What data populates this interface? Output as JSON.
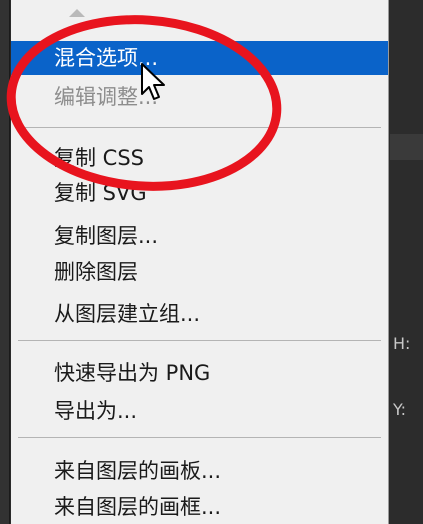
{
  "menu": {
    "items": [
      {
        "label": "混合选项...",
        "state": "highlighted"
      },
      {
        "label": "编辑调整...",
        "state": "disabled"
      },
      {
        "label": "复制 CSS",
        "state": "normal"
      },
      {
        "label": "复制 SVG",
        "state": "normal"
      },
      {
        "label": "复制图层...",
        "state": "normal"
      },
      {
        "label": "删除图层",
        "state": "normal"
      },
      {
        "label": "从图层建立组...",
        "state": "normal"
      },
      {
        "label": "快速导出为 PNG",
        "state": "normal"
      },
      {
        "label": "导出为...",
        "state": "normal"
      },
      {
        "label": "来自图层的画板...",
        "state": "normal"
      },
      {
        "label": "来自图层的画框...",
        "state": "normal"
      }
    ]
  },
  "background_panel": {
    "h_label": "H:",
    "y_label": "Y:"
  },
  "colors": {
    "menu_bg": "#f0f0f0",
    "highlight": "#0a63c9",
    "disabled_text": "#8d8d8d",
    "annotation_red": "#e8141e",
    "dark_bg": "#2a2a2a"
  },
  "icons": {
    "scroll_up": "triangle-up-icon",
    "cursor": "arrow-cursor-icon"
  }
}
